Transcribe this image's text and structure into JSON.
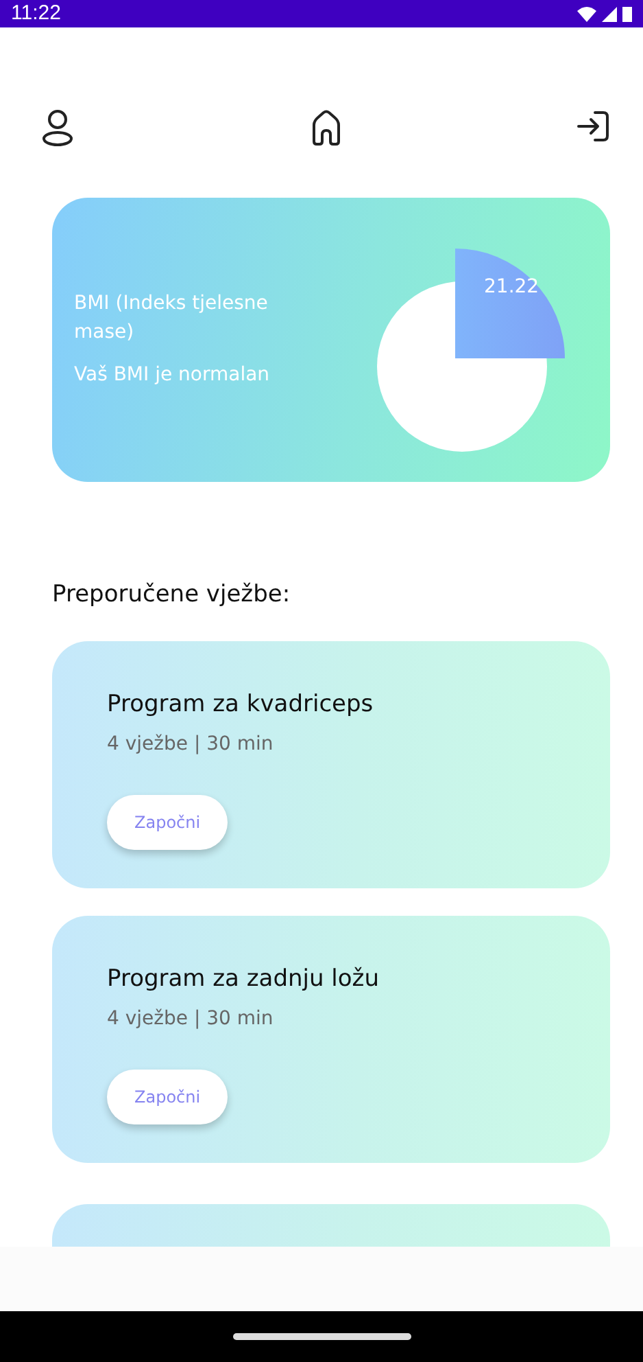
{
  "status_bar": {
    "time": "11:22"
  },
  "top_nav": [
    {
      "kind": "profile"
    },
    {
      "kind": "home"
    },
    {
      "kind": "logout"
    }
  ],
  "bmi_card": {
    "title": "BMI (Indeks tjelesne mase)",
    "status": "Vaš BMI je normalan",
    "value": "21.22"
  },
  "section_title": "Preporučene vježbe:",
  "programs": [
    {
      "title": "Program za kvadriceps",
      "details": "4 vježbe | 30 min",
      "button": "Započni"
    },
    {
      "title": "Program za zadnju ložu",
      "details": "4 vježbe | 30 min",
      "button": "Započni"
    }
  ],
  "partial_card": true
}
